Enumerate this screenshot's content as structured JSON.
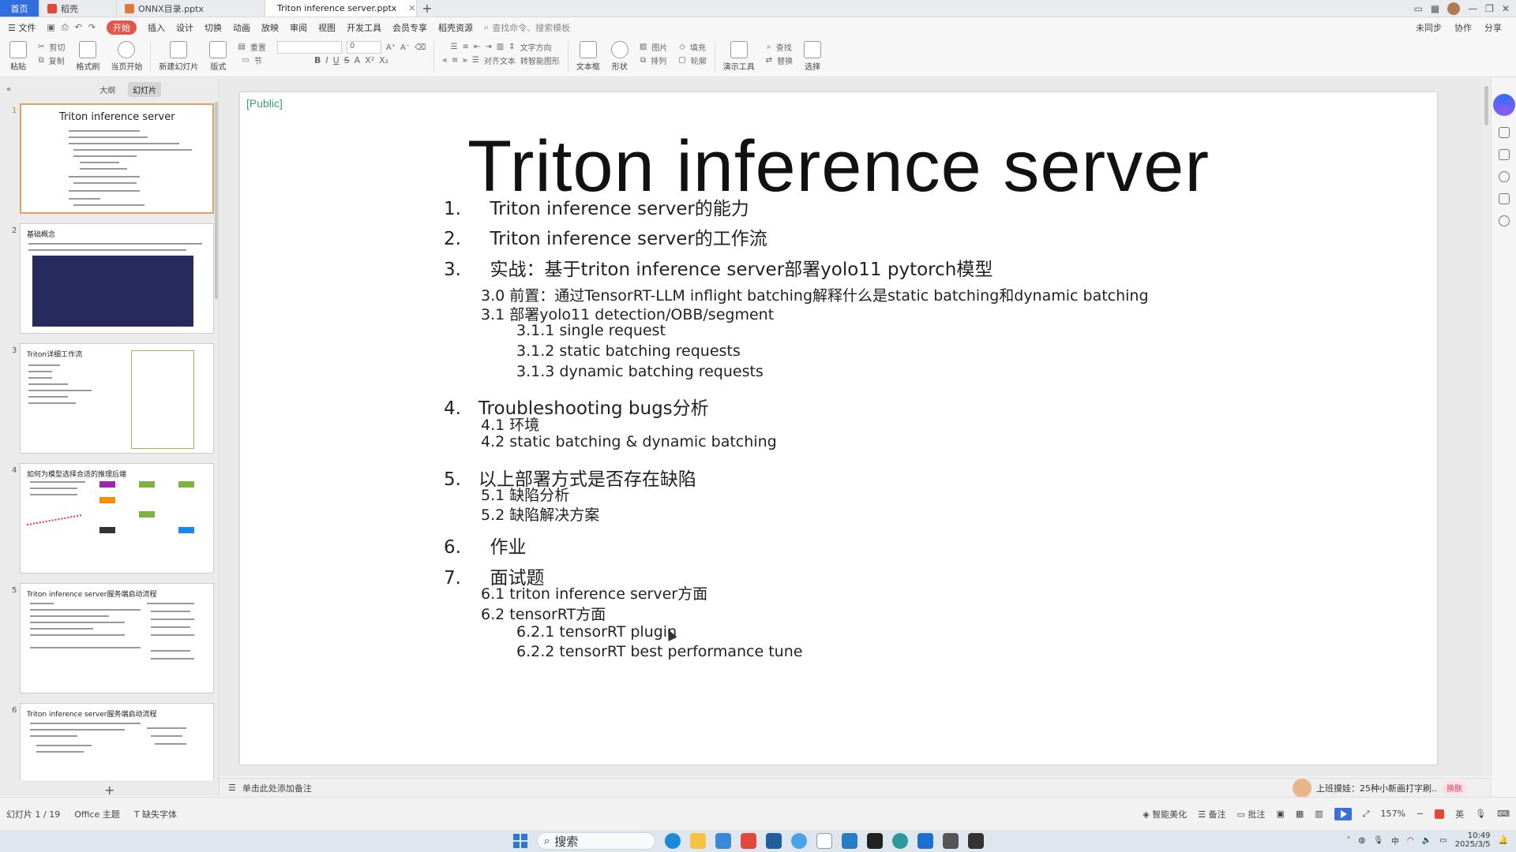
{
  "tabs": {
    "home": "首页",
    "items": [
      {
        "label": "稻壳",
        "color": "#e2483a"
      },
      {
        "label": "ONNX目录.pptx",
        "color": "#e0793b"
      },
      {
        "label": "Triton inference server.pptx",
        "color": "#e0793b"
      }
    ],
    "add": "+"
  },
  "menu": {
    "file": "文件",
    "items": [
      "开始",
      "插入",
      "设计",
      "切换",
      "动画",
      "放映",
      "审阅",
      "视图",
      "开发工具",
      "会员专享",
      "稻壳资源"
    ],
    "search_placeholder": "查找命令、搜索模板",
    "right": [
      "未同步",
      "协作",
      "分享"
    ]
  },
  "ribbon": {
    "paste": "粘贴",
    "cut": "剪切",
    "copy": "复制",
    "format_painter": "格式刷",
    "from_current": "当页开始",
    "new_slide": "新建幻灯片",
    "layout": "版式",
    "reset": "重置",
    "section": "节",
    "font_size": "0",
    "convert_to_shape": "转智能图形",
    "text_direction": "文字方向",
    "align_text": "对齐文本",
    "textbox": "文本框",
    "shape": "形状",
    "picture": "图片",
    "fill": "填充",
    "arrange": "排列",
    "outline": "轮廓",
    "presentation_tools": "演示工具",
    "find": "查找",
    "replace": "替换",
    "select": "选择"
  },
  "left_panel": {
    "tab_outline": "大纲",
    "tab_slides": "幻灯片",
    "slides": [
      {
        "num": "1",
        "title": "Triton inference server"
      },
      {
        "num": "2",
        "title": "基础概念"
      },
      {
        "num": "3",
        "title": "Triton详细工作流"
      },
      {
        "num": "4",
        "title": "如何为模型选择合适的推理后端"
      },
      {
        "num": "5",
        "title": "Triton inference server服务端启动流程"
      },
      {
        "num": "6",
        "title": "Triton inference server服务端启动流程"
      }
    ],
    "add": "+"
  },
  "slide": {
    "tag": "[Public]",
    "title": "Triton inference server",
    "toc": [
      {
        "text": "1.     Triton inference server的能力",
        "level": 1
      },
      {
        "text": "2.     Triton inference server的工作流",
        "level": 1
      },
      {
        "text": "3.     实战：基于triton inference server部署yolo11 pytorch模型",
        "level": 1
      },
      {
        "text": "3.0 前置：通过TensorRT-LLM inflight batching解释什么是static batching和dynamic batching",
        "level": 2
      },
      {
        "text": "3.1 部署yolo11 detection/OBB/segment",
        "level": 2
      },
      {
        "text": "3.1.1 single request",
        "level": 3
      },
      {
        "text": "3.1.2 static batching requests",
        "level": 3
      },
      {
        "text": "3.1.3 dynamic batching requests",
        "level": 3
      },
      {
        "text": "4.   Troubleshooting bugs分析",
        "level": 1
      },
      {
        "text": "4.1 环境",
        "level": 2
      },
      {
        "text": "4.2 static batching & dynamic batching",
        "level": 2
      },
      {
        "text": "5.   以上部署方式是否存在缺陷",
        "level": 1
      },
      {
        "text": "5.1 缺陷分析",
        "level": 2
      },
      {
        "text": "5.2 缺陷解决方案",
        "level": 2
      },
      {
        "text": "6.     作业",
        "level": 1
      },
      {
        "text": "7.     面试题",
        "level": 1
      },
      {
        "text": "6.1 triton inference server方面",
        "level": 2
      },
      {
        "text": "6.2 tensorRT方面",
        "level": 2
      },
      {
        "text": "6.2.1 tensorRT plugin",
        "level": 3
      },
      {
        "text": "6.2.2 tensorRT best performance tune",
        "level": 3
      }
    ]
  },
  "notes": {
    "placeholder": "单击此处添加备注",
    "promo_text": "上班摸娃：25种小新画打字刷..",
    "promo_btn": "换肤"
  },
  "status": {
    "slide_counter": "幻灯片 1 / 19",
    "theme": "Office 主题",
    "missing_font": "缺失字体",
    "smart_beautify": "智能美化",
    "notes": "备注",
    "comments": "批注",
    "zoom": "157%"
  },
  "taskbar": {
    "search": "搜索",
    "ime": "英",
    "time": "10:49",
    "date": "2025/3/5"
  }
}
